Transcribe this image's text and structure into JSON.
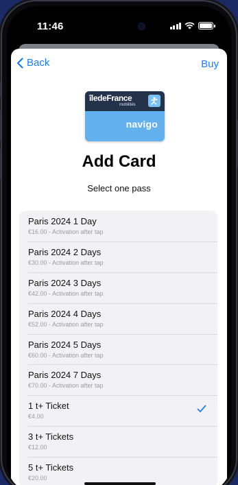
{
  "status_bar": {
    "time": "11:46"
  },
  "nav": {
    "back_label": "Back",
    "buy_label": "Buy"
  },
  "card": {
    "brand": "îledeFrance",
    "brand_sub": "mobilités",
    "product": "navigo"
  },
  "header": {
    "title": "Add Card",
    "subtitle": "Select one pass"
  },
  "passes": [
    {
      "name": "Paris 2024 1 Day",
      "detail": "€16.00 - Activation after tap",
      "selected": false
    },
    {
      "name": "Paris 2024 2 Days",
      "detail": "€30.00 - Activation after tap",
      "selected": false
    },
    {
      "name": "Paris 2024 3 Days",
      "detail": "€42.00 - Activation after tap",
      "selected": false
    },
    {
      "name": "Paris 2024 4 Days",
      "detail": "€52.00 - Activation after tap",
      "selected": false
    },
    {
      "name": "Paris 2024 5 Days",
      "detail": "€60.00 - Activation after tap",
      "selected": false
    },
    {
      "name": "Paris 2024 7 Days",
      "detail": "€70.00 - Activation after tap",
      "selected": false
    },
    {
      "name": "1 t+ Ticket",
      "detail": "€4.00",
      "selected": true
    },
    {
      "name": "3 t+ Tickets",
      "detail": "€12.00",
      "selected": false
    },
    {
      "name": "5 t+ Tickets",
      "detail": "€20.00",
      "selected": false
    }
  ],
  "colors": {
    "accent": "#1a7cf0",
    "card_blue": "#62b1ee",
    "card_dark": "#24334a"
  },
  "icons": [
    "chevron-left-icon",
    "checkmark-icon",
    "signal-icon",
    "wifi-icon",
    "battery-icon"
  ]
}
